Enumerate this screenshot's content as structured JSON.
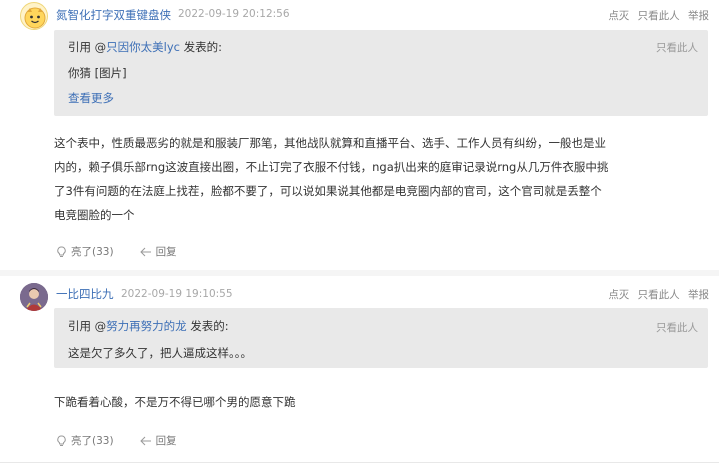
{
  "comments": [
    {
      "username": "氮智化打字双重键盘侠",
      "time": "2022-09-19 20:12:56",
      "actions": [
        "点灭",
        "只看此人",
        "举报"
      ],
      "quote": {
        "prefix": "引用 @",
        "user": "只因你太美lyc",
        "suffix": " 发表的:",
        "only_this": "只看此人",
        "body": "你猜 [图片]",
        "more": "查看更多"
      },
      "body_lines": [
        "这个表中，性质最恶劣的就是和服装厂那笔，其他战队就算和直播平台、选手、工作人员有纠纷，一般也是业",
        "内的，赖子俱乐部rng这波直接出圈，不止订完了衣服不付钱，nga扒出来的庭审记录说rng从几万件衣服中挑",
        "了3件有问题的在法庭上找茬，脸都不要了，可以说如果说其他都是电竞圈内部的官司，这个官司就是丢整个",
        "电竞圈脸的一个"
      ],
      "likes": "亮了(33)",
      "reply": "回复"
    },
    {
      "username": "一比四比九",
      "time": "2022-09-19 19:10:55",
      "actions": [
        "点灭",
        "只看此人",
        "举报"
      ],
      "quote": {
        "prefix": "引用 @",
        "user": "努力再努力的龙",
        "suffix": " 发表的:",
        "only_this": "只看此人",
        "body": "这是欠了多久了，把人逼成这样。。。"
      },
      "body_lines": [
        "下跪看着心酸，不是万不得已哪个男的愿意下跪"
      ],
      "likes": "亮了(33)",
      "reply": "回复"
    }
  ],
  "icons": {
    "like": "lightbulb-icon",
    "reply": "reply-arrow-icon"
  },
  "colors": {
    "link": "#3d6fb6",
    "quote_bg": "#e9e9e9",
    "page_bg": "#f5f5f5"
  }
}
